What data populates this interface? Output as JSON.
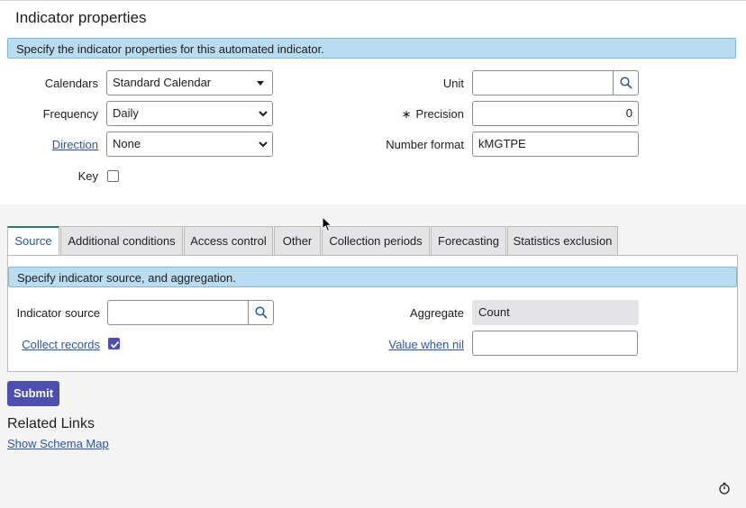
{
  "header": {
    "title": "Indicator properties"
  },
  "info": {
    "properties_message": "Specify the indicator properties for this automated indicator."
  },
  "form": {
    "calendars": {
      "label": "Calendars",
      "value": "Standard Calendar"
    },
    "frequency": {
      "label": "Frequency",
      "value": "Daily"
    },
    "direction": {
      "label": "Direction",
      "value": "None"
    },
    "key": {
      "label": "Key",
      "checked": false
    },
    "unit": {
      "label": "Unit",
      "value": ""
    },
    "precision": {
      "label": "Precision",
      "required_mark": "∗",
      "value": "0"
    },
    "number_format": {
      "label": "Number format",
      "value": "kMGTPE"
    }
  },
  "tabs": [
    {
      "label": "Source",
      "active": true
    },
    {
      "label": "Additional conditions"
    },
    {
      "label": "Access control"
    },
    {
      "label": "Other"
    },
    {
      "label": "Collection periods"
    },
    {
      "label": "Forecasting"
    },
    {
      "label": "Statistics exclusion"
    }
  ],
  "source_tab": {
    "message": "Specify indicator source, and aggregation.",
    "indicator_source": {
      "label": "Indicator source",
      "value": ""
    },
    "collect_records": {
      "label": "Collect records",
      "checked": true
    },
    "aggregate": {
      "label": "Aggregate",
      "value": "Count"
    },
    "value_when_nil": {
      "label": "Value when nil",
      "value": ""
    }
  },
  "actions": {
    "submit_label": "Submit"
  },
  "related": {
    "title": "Related Links",
    "show_schema_map": "Show Schema Map"
  },
  "colors": {
    "accent": "#4c4fb0",
    "info_bar": "#b9dcf1",
    "link": "#2c55a6",
    "active_tab_border": "#2e7d5e"
  }
}
